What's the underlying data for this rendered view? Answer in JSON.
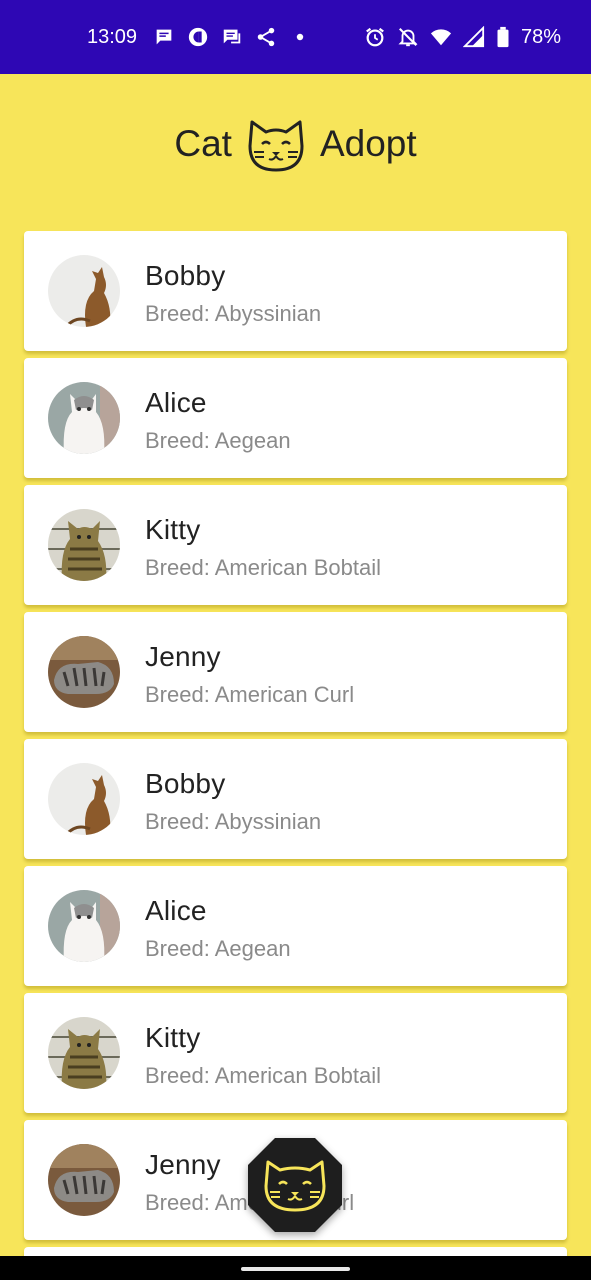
{
  "status_bar": {
    "time": "13:09",
    "battery": "78%",
    "left_icons": [
      "chat-bubble-icon",
      "c-circle-icon",
      "message-icon",
      "share-icon",
      "dot-icon"
    ],
    "right_icons": [
      "alarm-icon",
      "bell-off-icon",
      "wifi-icon",
      "signal-icon",
      "battery-icon"
    ],
    "background": "#2E07B4"
  },
  "header": {
    "title_left": "Cat",
    "title_right": "Adopt",
    "logo_icon": "cat-face-icon"
  },
  "theme": {
    "background": "#F7E55A",
    "fab_background": "#1E1E1E",
    "fab_icon_color": "#F7E55A"
  },
  "cats": [
    {
      "name": "Bobby",
      "breed": "Breed: Abyssinian",
      "photo": "abyssinian"
    },
    {
      "name": "Alice",
      "breed": "Breed: Aegean",
      "photo": "aegean"
    },
    {
      "name": "Kitty",
      "breed": "Breed: American Bobtail",
      "photo": "bobtail"
    },
    {
      "name": "Jenny",
      "breed": "Breed: American Curl",
      "photo": "curl"
    },
    {
      "name": "Bobby",
      "breed": "Breed: Abyssinian",
      "photo": "abyssinian"
    },
    {
      "name": "Alice",
      "breed": "Breed: Aegean",
      "photo": "aegean"
    },
    {
      "name": "Kitty",
      "breed": "Breed: American Bobtail",
      "photo": "bobtail"
    },
    {
      "name": "Jenny",
      "breed": "Breed: American Curl",
      "photo": "curl"
    }
  ],
  "fab": {
    "icon": "cat-face-icon"
  }
}
